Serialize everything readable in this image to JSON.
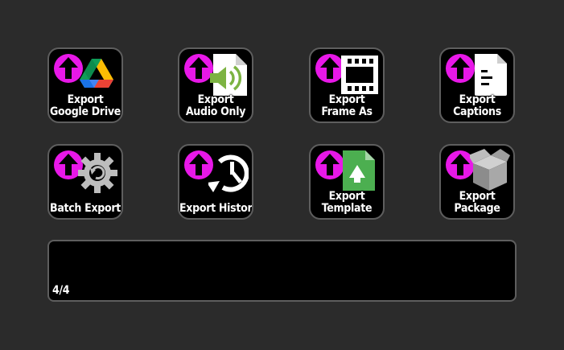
{
  "accent_color": "#e818e8",
  "buttons": [
    {
      "line1": "Export",
      "line2": "Google Drive",
      "icon": "google-drive-icon"
    },
    {
      "line1": "Export",
      "line2": "Audio Only",
      "icon": "audio-file-icon"
    },
    {
      "line1": "Export",
      "line2": "Frame As",
      "icon": "film-frame-icon"
    },
    {
      "line1": "Export",
      "line2": "Captions",
      "icon": "captions-document-icon"
    },
    {
      "line1": "",
      "line2": "Batch Export",
      "icon": "gear-refresh-icon"
    },
    {
      "line1": "",
      "line2": "Export History",
      "icon": "history-clock-icon"
    },
    {
      "line1": "Export",
      "line2": "Template",
      "icon": "template-file-icon"
    },
    {
      "line1": "Export",
      "line2": "Package",
      "icon": "package-box-icon"
    }
  ],
  "badge_icon": "upload-arrow-icon",
  "info_panel": {
    "page_indicator": "4/4"
  }
}
